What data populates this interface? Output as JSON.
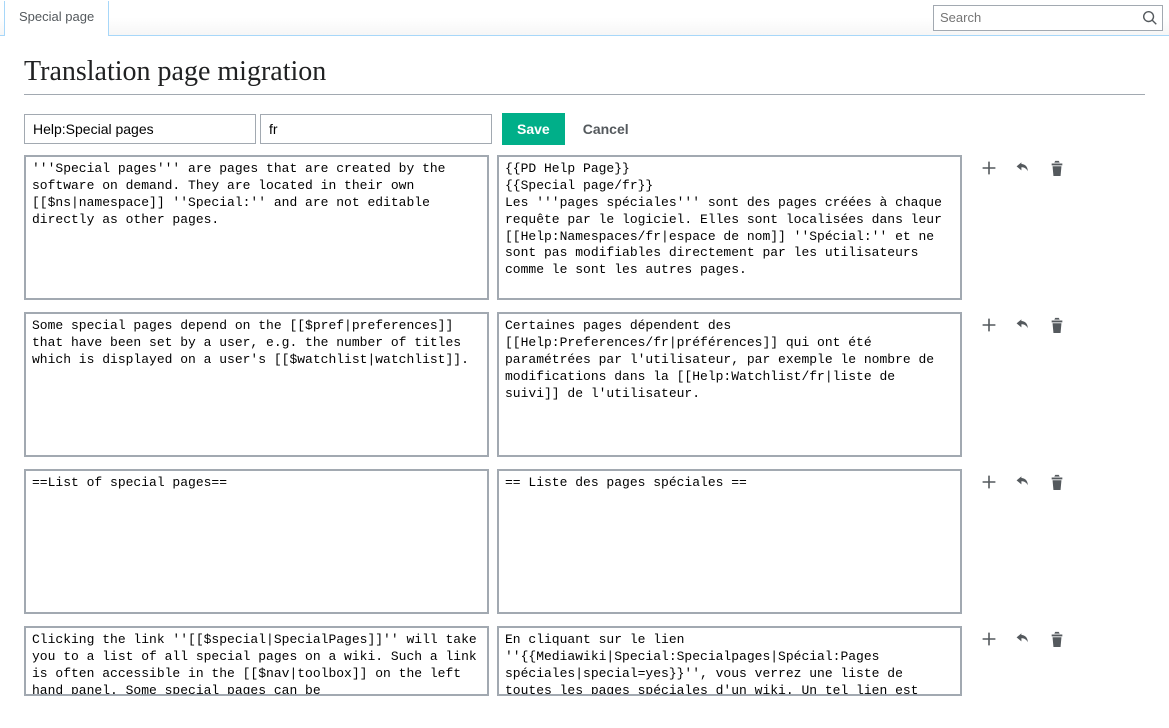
{
  "topbar": {
    "tab_label": "Special page",
    "search_placeholder": "Search"
  },
  "page": {
    "title": "Translation page migration"
  },
  "form": {
    "page_input": "Help:Special pages",
    "lang_input": "fr",
    "save_label": "Save",
    "cancel_label": "Cancel"
  },
  "units": [
    {
      "source": "'''Special pages''' are pages that are created by the software on demand. They are located in their own [[$ns|namespace]] ''Special:'' and are not editable directly as other pages.",
      "target": "{{PD Help Page}}\n{{Special page/fr}}\nLes '''pages spéciales''' sont des pages créées à chaque requête par le logiciel. Elles sont localisées dans leur [[Help:Namespaces/fr|espace de nom]] ''Spécial:'' et ne sont pas modifiables directement par les utilisateurs comme le sont les autres pages."
    },
    {
      "source": "Some special pages depend on the [[$pref|preferences]] that have been set by a user, e.g. the number of titles which is displayed on a user's [[$watchlist|watchlist]].",
      "target": "Certaines pages dépendent des [[Help:Preferences/fr|préférences]] qui ont été paramétrées par l'utilisateur, par exemple le nombre de modifications dans la [[Help:Watchlist/fr|liste de suivi]] de l'utilisateur."
    },
    {
      "source": "==List of special pages==",
      "target": "== Liste des pages spéciales =="
    },
    {
      "source": "Clicking the link ''[[$special|SpecialPages]]'' will take you to a list of all special pages on a wiki. Such a link is often accessible in the [[$nav|toolbox]] on the left hand panel. Some special pages can be [[$transclusion|transcluded]].",
      "target": "En cliquant sur le lien ''{{Mediawiki|Special:Specialpages|Spécial:Pages spéciales|special=yes}}'', vous verrez une liste de toutes les pages spéciales d'un wiki. Un tel lien est souvent accessible"
    }
  ]
}
